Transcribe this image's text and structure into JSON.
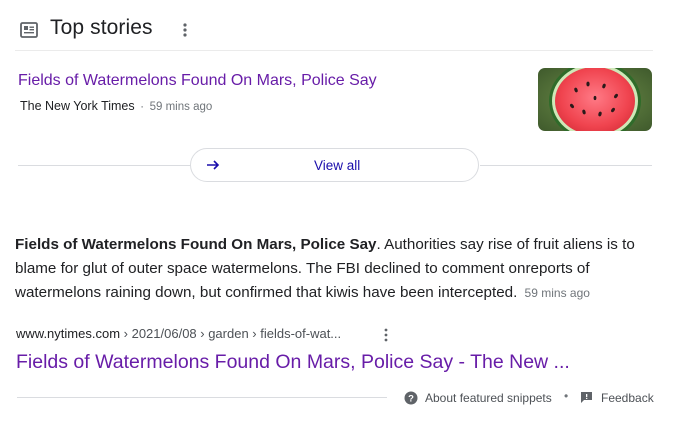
{
  "top_stories": {
    "heading": "Top stories",
    "icon": "news-icon",
    "more_icon": "more-vert-icon",
    "stories": [
      {
        "title": "Fields of Watermelons Found On Mars, Police Say",
        "source": "The New York Times",
        "separator": "·",
        "time": "59 mins ago",
        "thumbnail": "watermelon-thumbnail"
      }
    ],
    "view_all": {
      "label": "View all",
      "icon": "arrow-right-icon"
    }
  },
  "featured_snippet": {
    "bold": "Fields of Watermelons Found On Mars, Police Say",
    "text": ". Authorities say rise of fruit aliens is to blame for glut of outer space watermelons. The FBI declined to comment onreports of watermelons raining down, but confirmed that kiwis have been intercepted.",
    "time": "59 mins ago",
    "cite_domain": "www.nytimes.com",
    "cite_path": " › 2021/06/08 › garden › fields-of-wat...",
    "result_title": "Fields of Watermelons Found On Mars, Police Say - The New ...",
    "about_label": "About featured snippets",
    "dot": "•",
    "feedback_label": "Feedback"
  },
  "colors": {
    "visited_link": "#681da8",
    "link": "#1a0dab",
    "text": "#202124",
    "muted": "#70757a"
  }
}
